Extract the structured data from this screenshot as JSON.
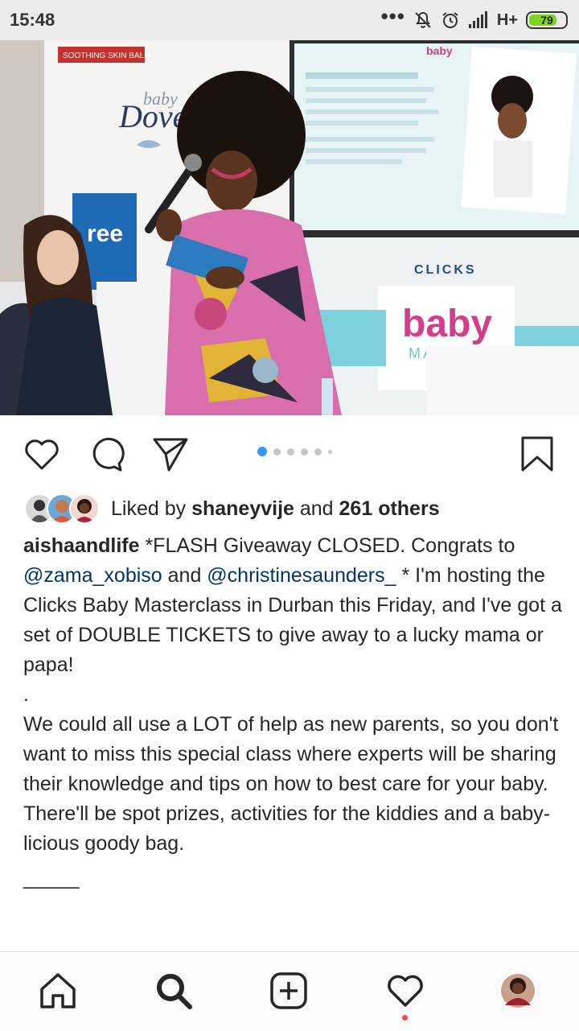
{
  "status_bar": {
    "time": "15:48",
    "dots": "•••",
    "network": "H+",
    "battery": "79",
    "battery_color": "#7ed321"
  },
  "post": {
    "photo": {
      "sign_top": "SOOTHING SKIN BALM",
      "brand_dove": "Dove",
      "brand_baby_small": "baby",
      "screen_logo": "baby",
      "clicks_logo": "CLICKS",
      "baby_logo": "baby",
      "master_text": "MASTER",
      "free_text": "ree"
    },
    "actions": {
      "like_icon": "heart-icon",
      "comment_icon": "comment-icon",
      "share_icon": "send-icon",
      "save_icon": "bookmark-icon"
    },
    "carousel": {
      "count": 6,
      "active_index": 0,
      "accent": "#3897f0"
    },
    "likes": {
      "prefix": "Liked by ",
      "user": "shaneyvije",
      "middle": " and ",
      "others": "261 others"
    },
    "caption": {
      "username": "aishaandlife",
      "line1": " *FLASH Giveaway CLOSED. Congrats to ",
      "mention1": "@zama_xobiso",
      "and": " and ",
      "mention2": "@christinesaunders_",
      "rest1": " * I'm hosting the Clicks Baby Masterclass in Durban this Friday, and I've got a set of DOUBLE TICKETS to give away to a lucky mama or papa!",
      "dot": ".",
      "paragraph2": "We could all use a LOT of help as new parents, so you don't want to miss this special class where experts will be sharing their knowledge and tips on how to best care for your baby. There'll be spot prizes, activities for the kiddies and a baby-licious goody bag.",
      "separator": "_____"
    }
  },
  "bottom_nav": {
    "items": [
      "home-icon",
      "search-icon",
      "new-post-icon",
      "activity-icon",
      "profile-avatar"
    ]
  }
}
